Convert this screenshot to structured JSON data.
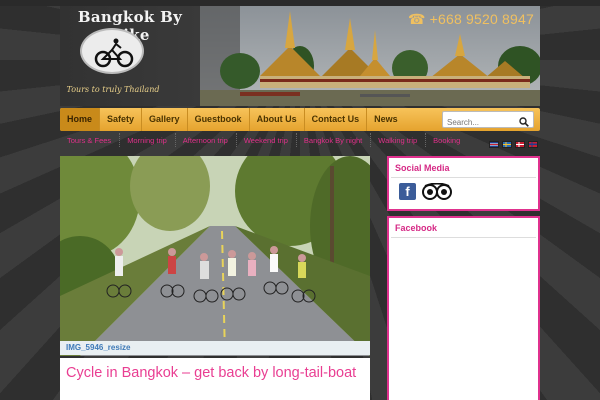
{
  "header": {
    "site_title": "Bangkok By Bike",
    "tagline": "Tours to truly Thailand",
    "phone": "+668 9520 8947",
    "logo_icon": "bicycle-rider-logo",
    "phone_icon": "telephone-icon"
  },
  "nav": {
    "items": [
      {
        "label": "Home",
        "active": true
      },
      {
        "label": "Safety",
        "active": false
      },
      {
        "label": "Gallery",
        "active": false
      },
      {
        "label": "Guestbook",
        "active": false
      },
      {
        "label": "About Us",
        "active": false
      },
      {
        "label": "Contact Us",
        "active": false
      },
      {
        "label": "News",
        "active": false
      }
    ],
    "search_placeholder": "Search..."
  },
  "subnav": {
    "items": [
      "Tours & Fees",
      "Morning trip",
      "Afternoon trip",
      "Weekend trip",
      "Bangkok By night",
      "Walking trip",
      "Booking"
    ]
  },
  "languages": [
    {
      "name": "english-flag",
      "colors": [
        "#1f3f8f",
        "#ffffff",
        "#cc2233"
      ]
    },
    {
      "name": "swedish-flag",
      "colors": [
        "#2a6fb8",
        "#f2c230"
      ]
    },
    {
      "name": "danish-flag",
      "colors": [
        "#c81e32",
        "#ffffff"
      ]
    },
    {
      "name": "norwegian-flag",
      "colors": [
        "#c81e32",
        "#ffffff",
        "#1f3f8f"
      ]
    }
  ],
  "main": {
    "photo_caption": "IMG_5946_resize",
    "post_title": "Cycle in Bangkok – get back by long-tail-boat"
  },
  "sidebar": {
    "social_title": "Social Media",
    "social_icons": [
      "facebook-icon",
      "tripadvisor-icon"
    ],
    "facebook_title": "Facebook"
  },
  "colors": {
    "accent_pink": "#e0318e",
    "nav_gold": "#f0b444",
    "background": "#3a3a3a",
    "caption_blue": "#3f7ab8"
  }
}
